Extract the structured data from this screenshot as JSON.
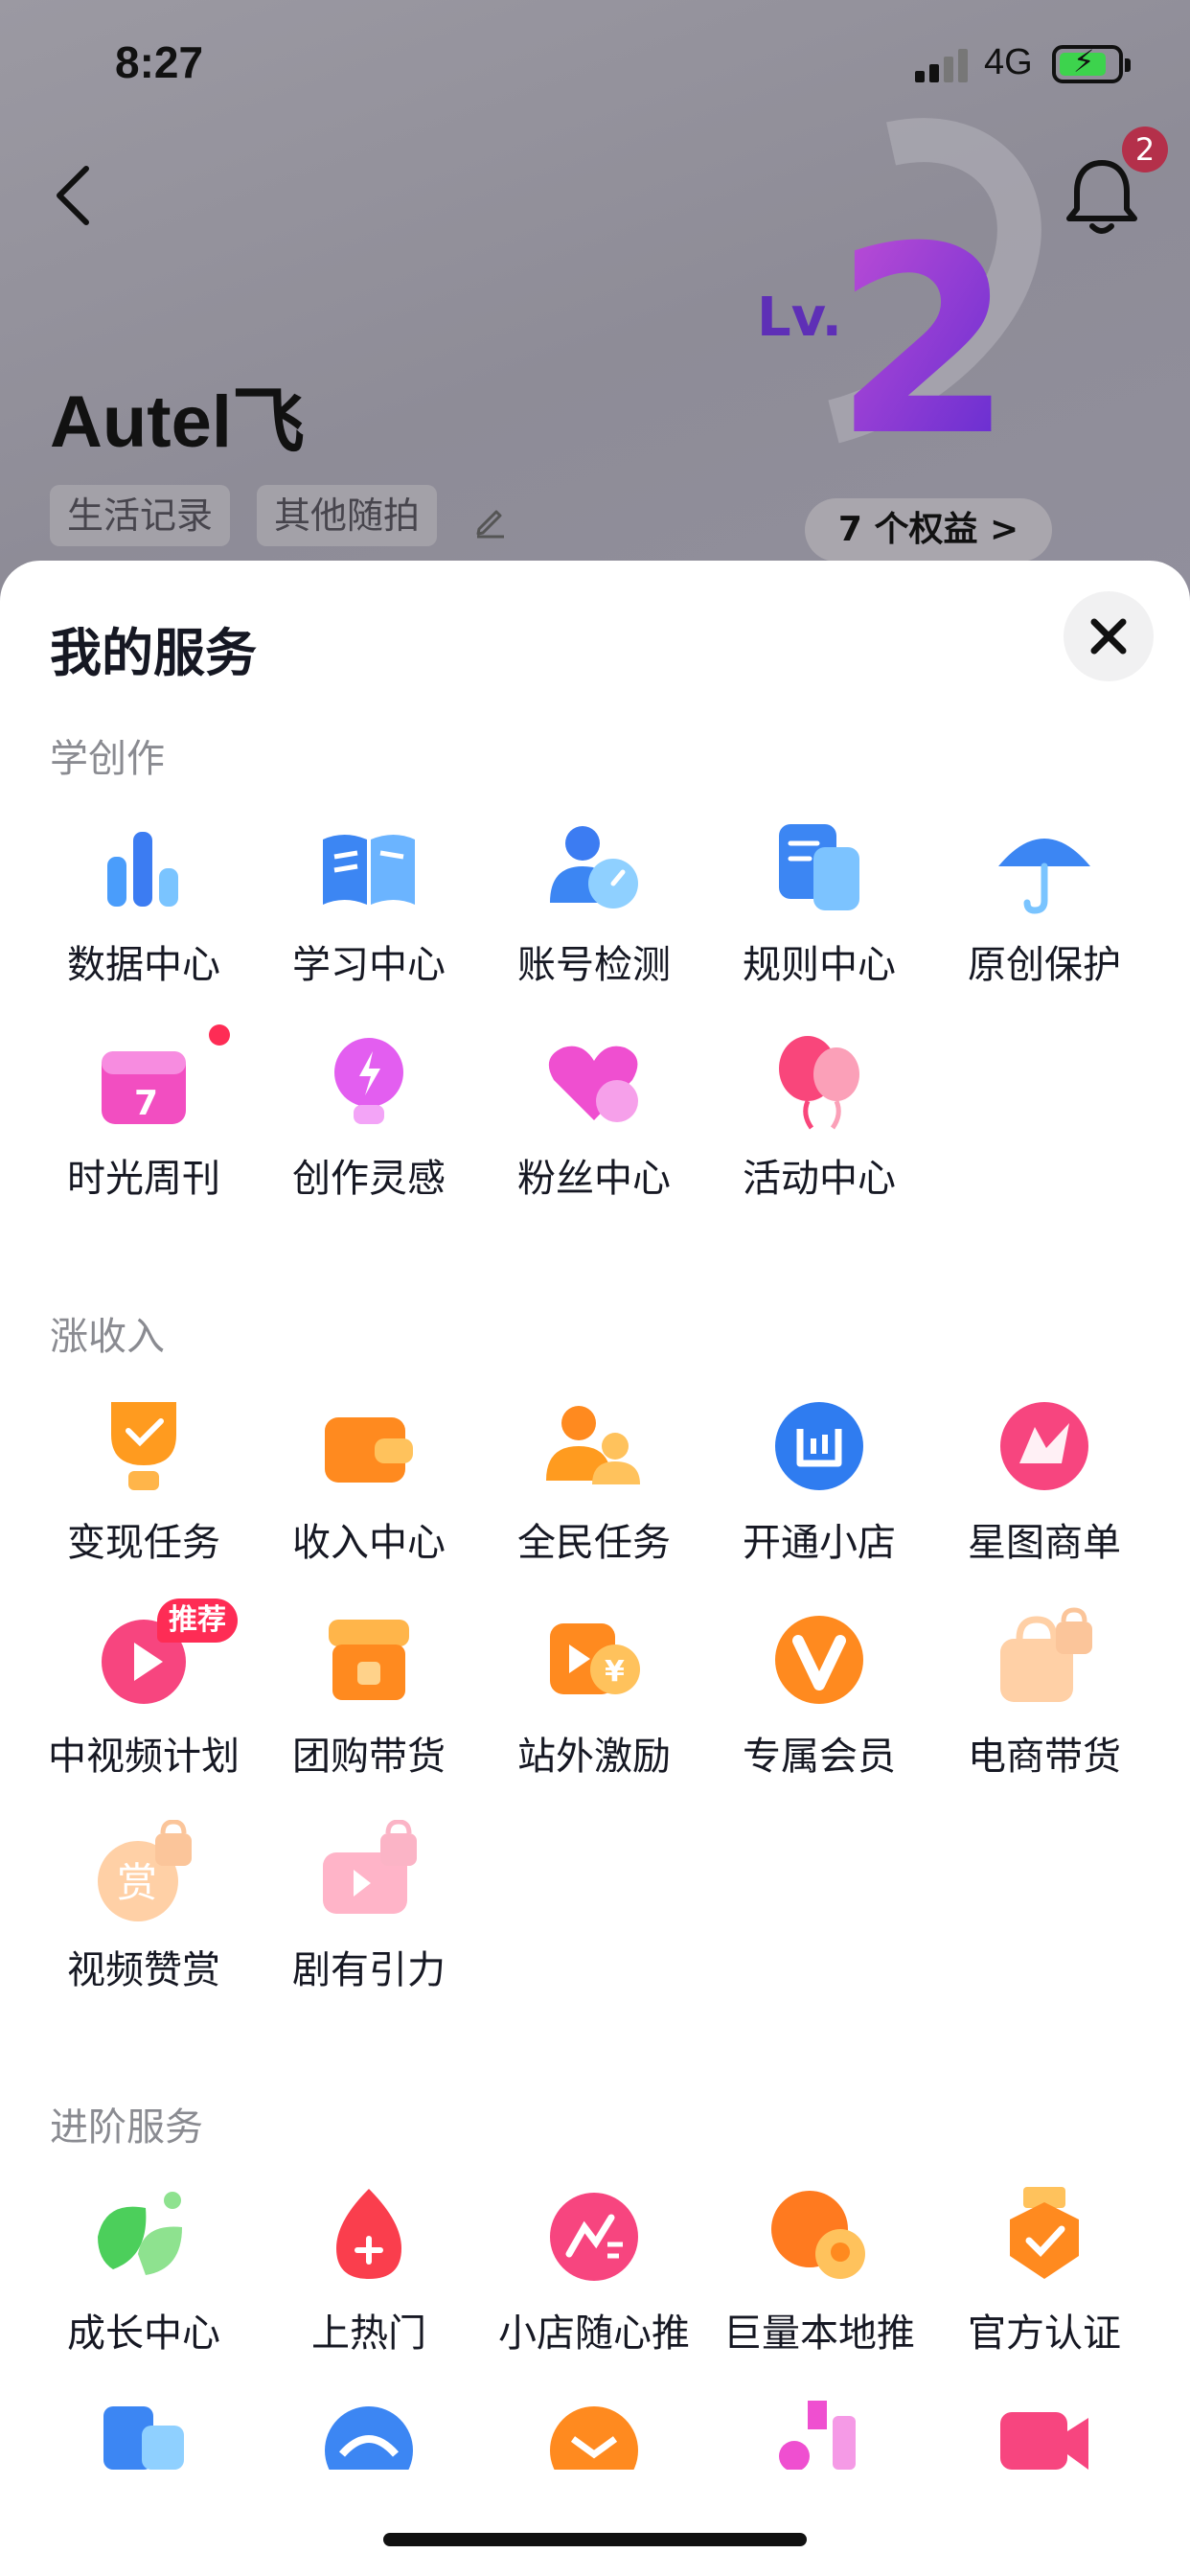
{
  "status_bar": {
    "time": "8:27",
    "network": "4G"
  },
  "header": {
    "back_icon": "chevron-left-icon",
    "notification_icon": "bell-icon",
    "notification_count": "2",
    "username": "Autel飞",
    "level_text": "Lv.",
    "level_number": "2",
    "tags": [
      "生活记录",
      "其他随拍"
    ],
    "benefits_label": "7 个权益 >"
  },
  "sheet": {
    "title": "我的服务",
    "close_icon": "close-icon",
    "sections": [
      {
        "title": "学创作",
        "items": [
          {
            "label": "数据中心",
            "icon": "bar-chart-icon"
          },
          {
            "label": "学习中心",
            "icon": "open-book-icon"
          },
          {
            "label": "账号检测",
            "icon": "account-check-icon"
          },
          {
            "label": "规则中心",
            "icon": "document-icon"
          },
          {
            "label": "原创保护",
            "icon": "umbrella-icon"
          },
          {
            "label": "时光周刊",
            "icon": "calendar-icon",
            "dot": true
          },
          {
            "label": "创作灵感",
            "icon": "lightbulb-icon"
          },
          {
            "label": "粉丝中心",
            "icon": "heart-icon"
          },
          {
            "label": "活动中心",
            "icon": "balloons-icon"
          }
        ]
      },
      {
        "title": "涨收入",
        "items": [
          {
            "label": "变现任务",
            "icon": "trophy-icon"
          },
          {
            "label": "收入中心",
            "icon": "wallet-icon"
          },
          {
            "label": "全民任务",
            "icon": "people-icon"
          },
          {
            "label": "开通小店",
            "icon": "shop-icon"
          },
          {
            "label": "星图商单",
            "icon": "star-map-icon"
          },
          {
            "label": "中视频计划",
            "icon": "video-play-icon",
            "badge": "推荐"
          },
          {
            "label": "团购带货",
            "icon": "storefront-icon"
          },
          {
            "label": "站外激励",
            "icon": "yuan-video-icon"
          },
          {
            "label": "专属会员",
            "icon": "vip-icon"
          },
          {
            "label": "电商带货",
            "icon": "shopping-bag-lock-icon"
          },
          {
            "label": "视频赞赏",
            "icon": "reward-lock-icon",
            "glyph": "赏"
          },
          {
            "label": "剧有引力",
            "icon": "drama-lock-icon"
          }
        ]
      },
      {
        "title": "进阶服务",
        "items": [
          {
            "label": "成长中心",
            "icon": "leaf-icon"
          },
          {
            "label": "上热门",
            "icon": "flame-icon"
          },
          {
            "label": "小店随心推",
            "icon": "promote-icon"
          },
          {
            "label": "巨量本地推",
            "icon": "location-pin-icon"
          },
          {
            "label": "官方认证",
            "icon": "badge-check-icon"
          }
        ]
      }
    ],
    "partial_icons": [
      "building-icon",
      "cloud-icon",
      "envelope-icon",
      "flask-icon",
      "camera-icon"
    ]
  }
}
